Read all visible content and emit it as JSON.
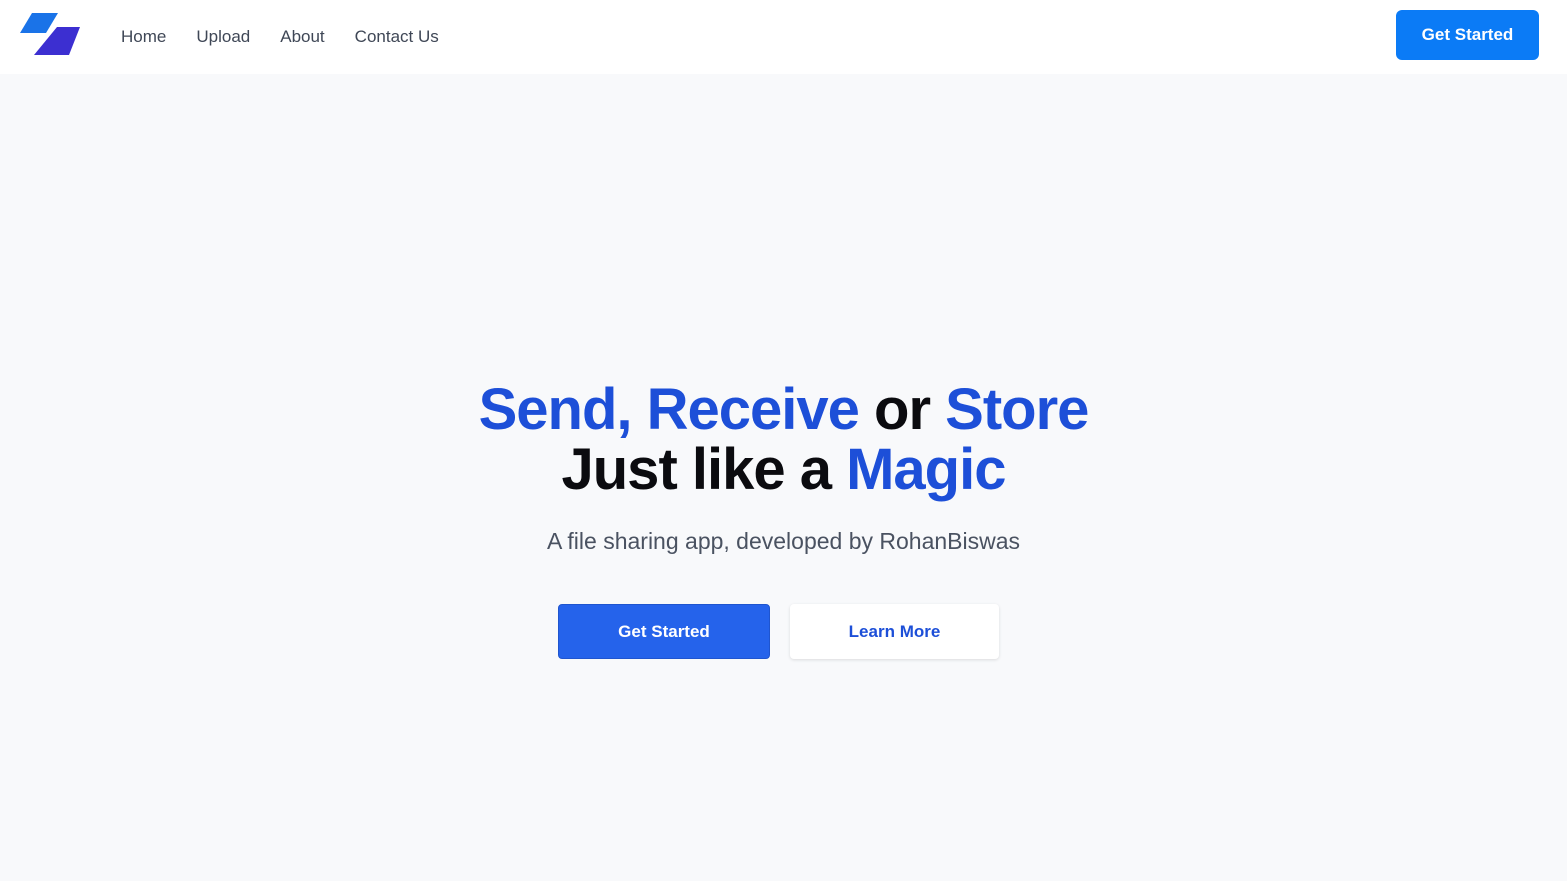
{
  "navbar": {
    "logo": {
      "icon": "parallelogram-logo-icon",
      "colors": [
        "#1a73e8",
        "#3c2fd1"
      ]
    },
    "links": [
      {
        "label": "Home"
      },
      {
        "label": "Upload"
      },
      {
        "label": "About"
      },
      {
        "label": "Contact Us"
      }
    ],
    "cta_label": "Get Started"
  },
  "hero": {
    "headline": {
      "line1": [
        {
          "text": "Send, Receive",
          "style": "blue"
        },
        {
          "text": " or ",
          "style": "dark"
        },
        {
          "text": "Store",
          "style": "blue"
        }
      ],
      "line2": [
        {
          "text": "Just like a ",
          "style": "dark"
        },
        {
          "text": "Magic",
          "style": "blue"
        }
      ]
    },
    "subtitle": "A file sharing app, developed by RohanBiswas",
    "primary_button": "Get Started",
    "secondary_button": "Learn More"
  },
  "colors": {
    "accent": "#0b7bf6",
    "headline_blue": "#1d4fd8",
    "primary_button": "#2563eb",
    "background": "#f8f9fb"
  }
}
